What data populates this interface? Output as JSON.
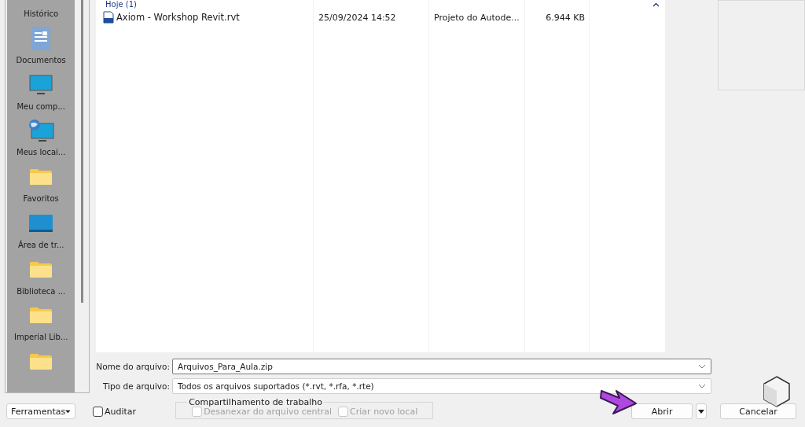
{
  "sidebar": {
    "items": [
      {
        "label": "Histórico",
        "kind": "none"
      },
      {
        "label": "Documentos",
        "kind": "document"
      },
      {
        "label": "Meu comp...",
        "kind": "monitor"
      },
      {
        "label": "Meus locai...",
        "kind": "network"
      },
      {
        "label": "Favoritos",
        "kind": "folder"
      },
      {
        "label": "Área de tr...",
        "kind": "desktop"
      },
      {
        "label": "Biblioteca ...",
        "kind": "folder"
      },
      {
        "label": "Imperial Lib...",
        "kind": "folder"
      },
      {
        "kind": "folder"
      }
    ]
  },
  "file_list": {
    "group": {
      "label": "Hoje (1)",
      "expanded": true
    },
    "rows": [
      {
        "name": "Axiom - Workshop Revit.rvt",
        "date": "25/09/2024 14:52",
        "type": "Projeto do Autode...",
        "size": "6.944 KB",
        "selected": false
      }
    ]
  },
  "form": [
    {
      "label": "Nome do arquivo:",
      "value": "Arquivos_Para_Aula.zip",
      "kind": "input"
    },
    {
      "label": "Tipo de arquivo:",
      "value": "Todos os arquivos suportados  (*.rvt, *.rfa, *.rte)",
      "kind": "select"
    }
  ],
  "footer": {
    "tools_button": "Ferramentas",
    "audit": {
      "label": "Auditar",
      "checked": false
    },
    "worksharing": {
      "title": "Compartilhamento de trabalho",
      "options": [
        {
          "label": "Desanexar do arquivo central",
          "checked": false,
          "disabled": true
        },
        {
          "label": "Criar novo local",
          "checked": false,
          "disabled": true
        }
      ]
    },
    "open_button": "Abrir",
    "cancel_button": "Cancelar"
  }
}
